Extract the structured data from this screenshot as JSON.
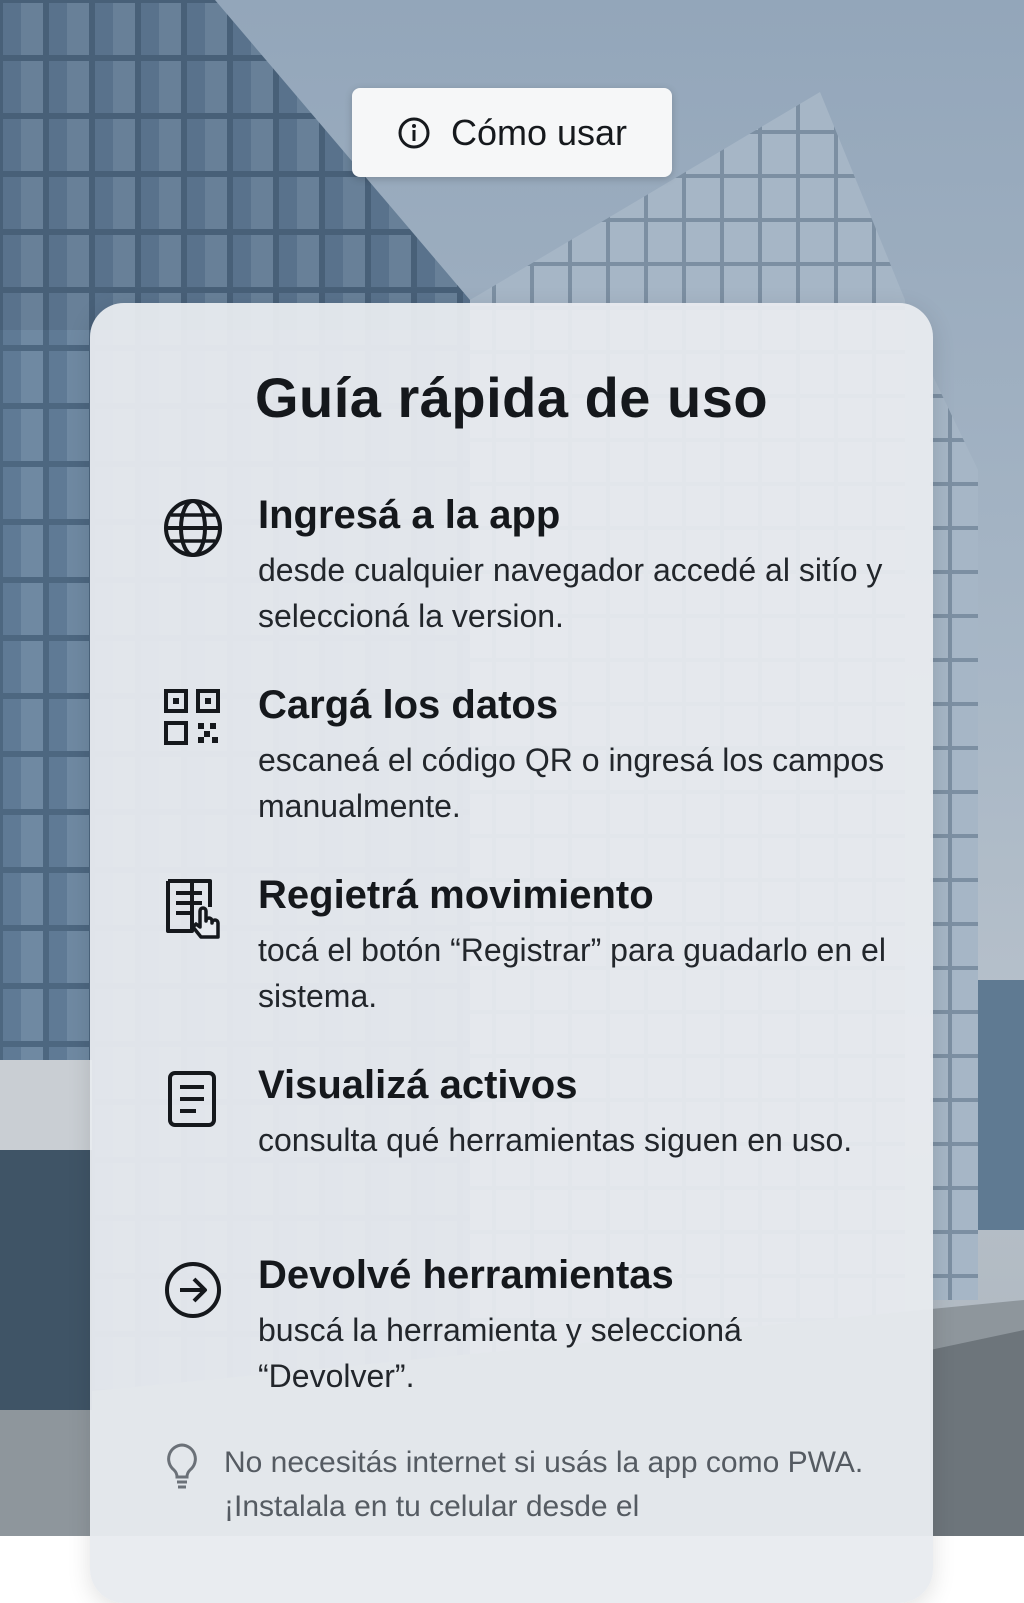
{
  "help_button": {
    "label": "Cómo usar",
    "icon": "info-icon"
  },
  "guide": {
    "title": "Guía rápida de uso",
    "steps": [
      {
        "icon": "globe-icon",
        "title": "Ingresá a la app",
        "description": "desde cualquier navegador accedé al sitío y seleccioná la version."
      },
      {
        "icon": "qr-code-icon",
        "title": "Cargá los datos",
        "description": "escaneá el código QR o ingresá los campos manualmente."
      },
      {
        "icon": "tap-document-icon",
        "title": "Regietrá movimiento",
        "description": "tocá el botón “Registrar” para guadarlo en el sistema."
      },
      {
        "icon": "document-list-icon",
        "title": "Visualizá activos",
        "description": "consulta qué herramientas siguen en uso."
      },
      {
        "icon": "arrow-right-circle-icon",
        "title": "Devolvé herramientas",
        "description": "buscá la herramienta y seleccioná “Devolver”."
      }
    ],
    "tip": {
      "icon": "lightbulb-icon",
      "text": "No necesitás internet si usás la app como PWA. ¡Instalala en tu celular desde el"
    }
  },
  "colors": {
    "card_background": "#e8ebef",
    "text_primary": "#15181c",
    "text_secondary": "#555b62",
    "sky": "#93a6ba",
    "glass": "#3e5a74"
  }
}
